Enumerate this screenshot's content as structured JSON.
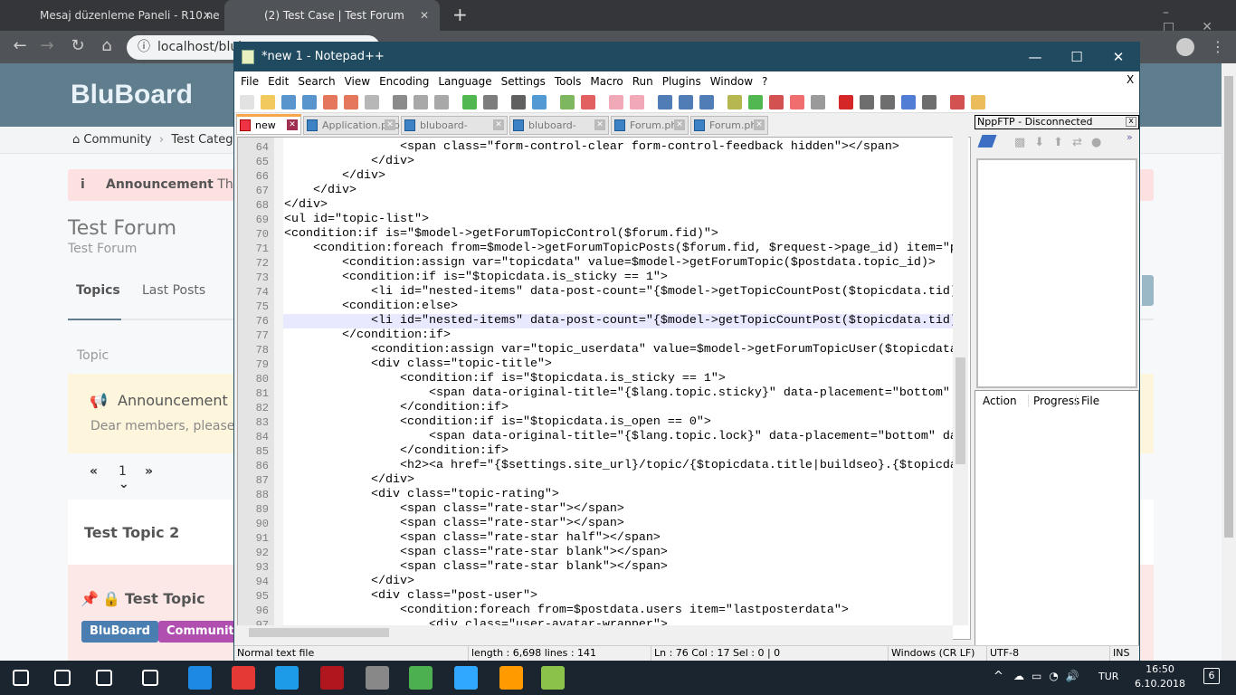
{
  "browser": {
    "tabs": [
      {
        "title": "Mesaj düzenleme Paneli - R10.ne"
      },
      {
        "title": "(2) Test Case | Test Forum"
      }
    ],
    "url": "localhost/blub",
    "new_tab": "+"
  },
  "page": {
    "logo": "BluBoard",
    "breadcrumb": [
      "Community",
      "Test Catego"
    ],
    "announcement_label": "Announcement",
    "announcement_text": "This so",
    "title": "Test Forum",
    "subtitle": "Test Forum",
    "tabs": [
      "Topics",
      "Last Posts"
    ],
    "topic_header": "Topic",
    "ann_box_title": "Announcement",
    "ann_box_text": "Dear members, please rea",
    "pager": {
      "prev": "«",
      "page": "1",
      "next": "»"
    },
    "topics": [
      {
        "title": "Test Topic 2"
      },
      {
        "title": "Test Topic",
        "tags": [
          {
            "label": "BluBoard",
            "color": "#4a7db0"
          },
          {
            "label": "Community",
            "color": "#b04fb0"
          }
        ]
      }
    ]
  },
  "npp": {
    "title": "*new 1 - Notepad++",
    "menu": [
      "File",
      "Edit",
      "Search",
      "View",
      "Encoding",
      "Language",
      "Settings",
      "Tools",
      "Macro",
      "Run",
      "Plugins",
      "Window",
      "?"
    ],
    "menu_close": "X",
    "toolbar": [
      [
        "new-file",
        "#ddd"
      ],
      [
        "open-file",
        "#f0c040"
      ],
      [
        "save",
        "#3c82c4"
      ],
      [
        "save-all",
        "#3c82c4"
      ],
      [
        "close",
        "#e06040"
      ],
      [
        "close-all",
        "#e06040"
      ],
      [
        "print",
        "#aaa"
      ],
      [
        "cut",
        "#777"
      ],
      [
        "copy",
        "#999"
      ],
      [
        "paste",
        "#999"
      ],
      [
        "undo",
        "#3a3"
      ],
      [
        "redo",
        "#666"
      ],
      [
        "find",
        "#444"
      ],
      [
        "replace",
        "#38c"
      ],
      [
        "zoom-in",
        "#6a4"
      ],
      [
        "zoom-out",
        "#d44"
      ],
      [
        "sync-v",
        "#e9a"
      ],
      [
        "sync-h",
        "#e9a"
      ],
      [
        "word-wrap",
        "#36a"
      ],
      [
        "all-chars",
        "#36a"
      ],
      [
        "indent-guide",
        "#36a"
      ],
      [
        "udl",
        "#aa3"
      ],
      [
        "doc-map",
        "#3a3"
      ],
      [
        "function-list",
        "#c33"
      ],
      [
        "folder-workspace",
        "#e55"
      ],
      [
        "monitor",
        "#888"
      ],
      [
        "record-macro",
        "#c00"
      ],
      [
        "stop-macro",
        "#555"
      ],
      [
        "play-macro",
        "#555"
      ],
      [
        "run-macro-multiple",
        "#36c"
      ],
      [
        "save-macro",
        "#555"
      ],
      [
        "spellcheck",
        "#c33"
      ],
      [
        "nppftp",
        "#e8b040"
      ]
    ],
    "files": [
      {
        "name": "new 1",
        "active": true
      },
      {
        "name": "Application.php"
      },
      {
        "name": "bluboard-core.css"
      },
      {
        "name": "bluboard-core.js"
      },
      {
        "name": "Forum.php"
      },
      {
        "name": "Forum.php"
      }
    ],
    "current_line": 76,
    "lines": [
      [
        "64",
        "                <span class=\"form-control-clear form-control-feedback hidden\"></span>"
      ],
      [
        "65",
        "            </div>"
      ],
      [
        "66",
        "        </div>"
      ],
      [
        "67",
        "    </div>"
      ],
      [
        "68",
        "</div>"
      ],
      [
        "69",
        "<ul id=\"topic-list\">"
      ],
      [
        "70",
        "<condition:if is=\"$model->getForumTopicControl($forum.fid)\">"
      ],
      [
        "71",
        "    <condition:foreach from=$model->getForumTopicPosts($forum.fid, $request->page_id) item=\"p"
      ],
      [
        "72",
        "        <condition:assign var=\"topicdata\" value=$model->getForumTopic($postdata.topic_id)>"
      ],
      [
        "73",
        "        <condition:if is=\"$topicdata.is_sticky == 1\">"
      ],
      [
        "74",
        "            <li id=\"nested-items\" data-post-count=\"{$model->getTopicCountPost($topicdata.tid)"
      ],
      [
        "75",
        "        <condition:else>"
      ],
      [
        "76",
        "            <li id=\"nested-items\" data-post-count=\"{$model->getTopicCountPost($topicdata.tid)"
      ],
      [
        "77",
        "        </condition:if>"
      ],
      [
        "78",
        "            <condition:assign var=\"topic_userdata\" value=$model->getForumTopicUser($topicdata"
      ],
      [
        "79",
        "            <div class=\"topic-title\">"
      ],
      [
        "80",
        "                <condition:if is=\"$topicdata.is_sticky == 1\">"
      ],
      [
        "81",
        "                    <span data-original-title=\"{$lang.topic.sticky}\" data-placement=\"bottom\""
      ],
      [
        "82",
        "                </condition:if>"
      ],
      [
        "83",
        "                <condition:if is=\"$topicdata.is_open == 0\">"
      ],
      [
        "84",
        "                    <span data-original-title=\"{$lang.topic.lock}\" data-placement=\"bottom\" da"
      ],
      [
        "85",
        "                </condition:if>"
      ],
      [
        "86",
        "                <h2><a href=\"{$settings.site_url}/topic/{$topicdata.title|buildseo}.{$topicda"
      ],
      [
        "87",
        "            </div>"
      ],
      [
        "88",
        "            <div class=\"topic-rating\">"
      ],
      [
        "89",
        "                <span class=\"rate-star\"></span>"
      ],
      [
        "90",
        "                <span class=\"rate-star\"></span>"
      ],
      [
        "91",
        "                <span class=\"rate-star half\"></span>"
      ],
      [
        "92",
        "                <span class=\"rate-star blank\"></span>"
      ],
      [
        "93",
        "                <span class=\"rate-star blank\"></span>"
      ],
      [
        "94",
        "            </div>"
      ],
      [
        "95",
        "            <div class=\"post-user\">"
      ],
      [
        "96",
        "                <condition:foreach from=$postdata.users item=\"lastposterdata\">"
      ],
      [
        "97",
        "                    <div class=\"user-avatar-wrapper\">"
      ]
    ],
    "ftp": {
      "title": "NppFTP - Disconnected",
      "close": "x",
      "more": "»",
      "queue_headers": [
        "Action",
        "Progress",
        "File"
      ]
    },
    "status": {
      "type": "Normal text file",
      "length": "length : 6,698    lines : 141",
      "pos": "Ln : 76    Col : 17    Sel : 0 | 0",
      "eol": "Windows (CR LF)",
      "enc": "UTF-8",
      "mode": "INS"
    }
  },
  "taskbar": {
    "apps": [
      [
        "windows-start",
        "#fff"
      ],
      [
        "search",
        "#fff"
      ],
      [
        "task-view",
        "#fff"
      ],
      [
        "mail",
        "#fff"
      ],
      [
        "edge",
        "#1e88e5"
      ],
      [
        "chrome",
        "#e53935"
      ],
      [
        "skype",
        "#1e9be8"
      ],
      [
        "filezilla",
        "#b0161e"
      ],
      [
        "obs",
        "#888"
      ],
      [
        "color-app",
        "#4caf50"
      ],
      [
        "photoshop",
        "#31a8ff"
      ],
      [
        "illustrator",
        "#ff9a00"
      ],
      [
        "notepadpp",
        "#8bc34a"
      ]
    ],
    "lang": "TUR",
    "time": "16:50",
    "date": "6.10.2018",
    "notifications": "6"
  }
}
